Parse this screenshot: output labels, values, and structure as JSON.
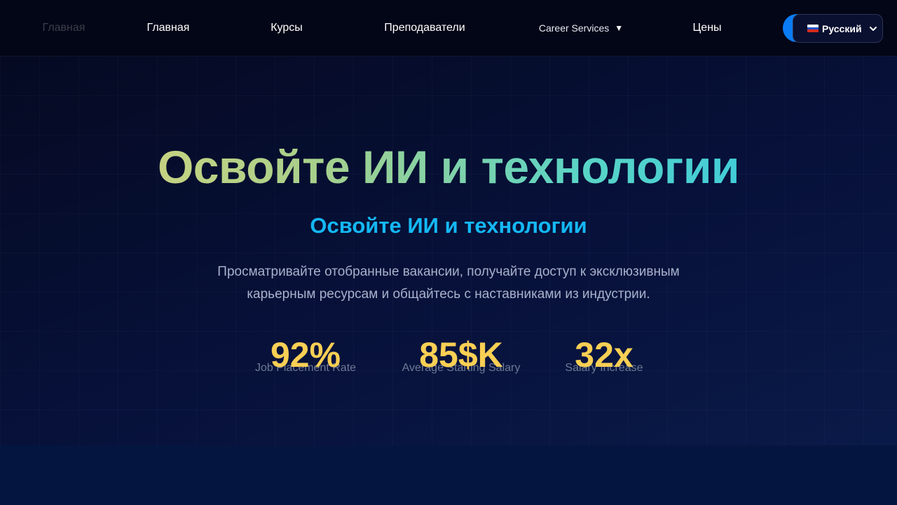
{
  "nav": {
    "items": [
      {
        "label": "Главная"
      },
      {
        "label": "Главная"
      },
      {
        "label": "Курсы"
      },
      {
        "label": "Преподаватели"
      },
      {
        "label": "Career Services"
      },
      {
        "label": "Цены"
      }
    ],
    "language": {
      "selected": "Русский",
      "icon": "russia-flag-icon"
    }
  },
  "hero": {
    "title": "Освойте ИИ и технологии",
    "subtitle": "Освойте ИИ и технологии",
    "description_line1": "Просматривайте отобранные вакансии, получайте доступ к эксклюзивным",
    "description_line2": "карьерным ресурсам и общайтесь с наставниками из индустрии.",
    "stats": [
      {
        "value": "92%",
        "label": "Job Placement Rate"
      },
      {
        "value": "85$K",
        "label": "Average Starting Salary"
      },
      {
        "value": "32x",
        "label": "Salary Increase"
      }
    ]
  },
  "colors": {
    "accent_blue": "#0a7cf5",
    "subtitle_cyan": "#14b8f5",
    "stat_yellow": "#f9cf54",
    "title_gradient_start": "#e3d579",
    "title_gradient_end": "#2bc6ea"
  }
}
